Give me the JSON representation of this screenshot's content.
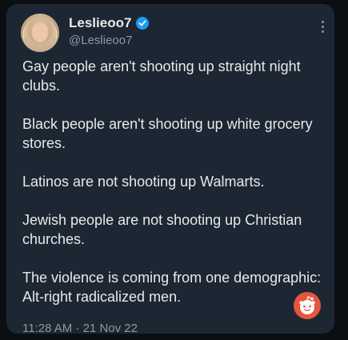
{
  "tweet": {
    "display_name": "Leslieoo7",
    "handle": "@Leslieoo7",
    "verified_icon": "verified-badge-icon",
    "more_icon": "more-options-icon",
    "paragraphs": [
      "Gay people aren't shooting up straight night clubs.",
      "Black people aren't shooting up white grocery stores.",
      "Latinos are not shooting up Walmarts.",
      "Jewish people are not shooting up Christian churches.",
      "The violence is coming from one demographic: Alt-right radicalized men."
    ],
    "timestamp": "11:28 AM · 21 Nov 22"
  },
  "overlay": {
    "icon": "reddit-icon"
  },
  "colors": {
    "background": "#0b0f14",
    "card": "#1d2733",
    "text": "#e7e9ea",
    "muted": "#8b98a5",
    "verified": "#1d9bf0",
    "reddit": "#e8553e"
  }
}
